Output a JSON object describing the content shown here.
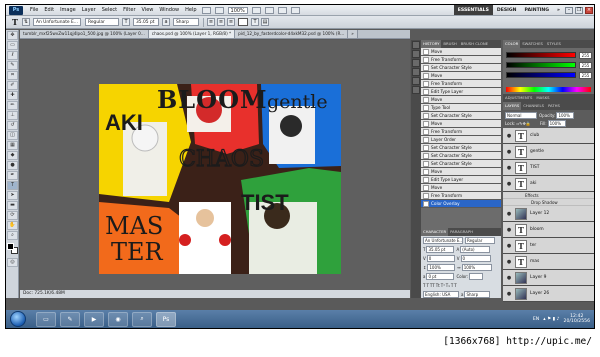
{
  "menubar": {
    "logo": "Ps",
    "items": [
      "File",
      "Edit",
      "Image",
      "Layer",
      "Select",
      "Filter",
      "View",
      "Window",
      "Help"
    ],
    "zoom": "100%",
    "workspaces": [
      "ESSENTIALS",
      "DESIGN",
      "PAINTING",
      "»"
    ]
  },
  "options": {
    "font_family": "An Unfortunate E...",
    "font_style": "Regular",
    "font_size": "35.05 pt",
    "antialias": "Sharp"
  },
  "doc_tabs": [
    "tumblr_mxf25wvZw11qj4lpo1_500.jpg @ 100% (Layer 0...",
    "chaos.psd @ 100% (Layer 1, RGB/8) *",
    "pid_12_by_fasterdcolor-d4xkM32.psd @ 100% (R...",
    "»"
  ],
  "artwork": {
    "title_top": "BLOOM",
    "title_top_right": "gentle",
    "word_left": "AKI",
    "word_center": "CHAOS",
    "word_bottom_left_1": "MAS",
    "word_bottom_left_2": "TER",
    "word_bottom_right": "TIST"
  },
  "status": "Doc: 725.1K/6.48M",
  "history": {
    "tabs": [
      "HISTORY",
      "BRUSH",
      "BRUSH CLONE"
    ],
    "items": [
      "Move",
      "Free Transform",
      "Set Character Style",
      "Move",
      "Free Transform",
      "Edit Type Layer",
      "Move",
      "Type Tool",
      "Set Character Style",
      "Move",
      "Free Transform",
      "Layer Order",
      "Set Character Style",
      "Set Character Style",
      "Set Character Style",
      "Move",
      "Edit Type Layer",
      "Move",
      "Free Transform",
      "Color Overlay"
    ],
    "selected_index": 19
  },
  "character": {
    "tabs": [
      "CHARACTER",
      "PARAGRAPH"
    ],
    "font": "An Unfortunate E...",
    "style": "Regular",
    "size": "35.05 pt",
    "leading": "(Auto)",
    "kerning": "0",
    "tracking": "0",
    "vscale": "100%",
    "hscale": "100%",
    "baseline": "0 pt",
    "color_label": "Color:",
    "language": "English: USA",
    "aa": "Sharp"
  },
  "color_panel": {
    "tabs": [
      "COLOR",
      "SWATCHES",
      "STYLES"
    ],
    "r": "255",
    "g": "255",
    "b": "255"
  },
  "adjust_tabs": [
    "ADJUSTMENTS",
    "MASKS"
  ],
  "layers": {
    "tabs": [
      "LAYERS",
      "CHANNELS",
      "PATHS"
    ],
    "blend": "Normal",
    "opacity_label": "Opacity:",
    "opacity": "100%",
    "fill_label": "Fill:",
    "fill": "100%",
    "lock_label": "Lock:",
    "rows": [
      {
        "name": "club",
        "type": "text"
      },
      {
        "name": "gentle",
        "type": "text"
      },
      {
        "name": "TIST",
        "type": "text"
      },
      {
        "name": "aki",
        "type": "text"
      },
      {
        "name": "Effects",
        "type": "sub"
      },
      {
        "name": "Drop Shadow",
        "type": "sub"
      },
      {
        "name": "Layer 12",
        "type": "image"
      },
      {
        "name": "bloom",
        "type": "text"
      },
      {
        "name": "ter",
        "type": "text"
      },
      {
        "name": "mas",
        "type": "text"
      },
      {
        "name": "Layer 9",
        "type": "image"
      },
      {
        "name": "Layer 26",
        "type": "image"
      }
    ]
  },
  "taskbar": {
    "lang": "EN",
    "time": "12:42",
    "date": "20/10/2556"
  },
  "caption": "[1366x768] http://upic.me/"
}
